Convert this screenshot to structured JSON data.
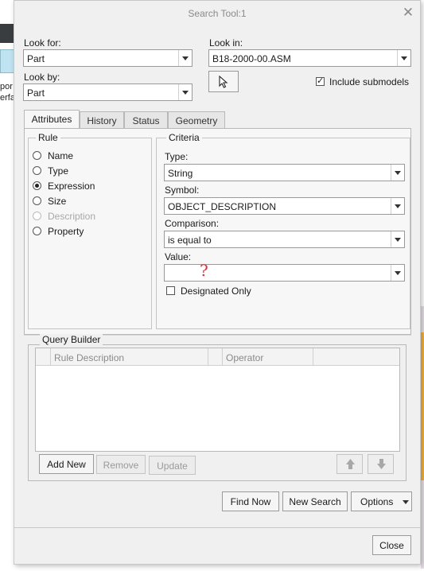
{
  "background_app": {
    "fragment_1": "por",
    "fragment_2": "erfa"
  },
  "dialog": {
    "title": "Search Tool:1",
    "close_glyph": "✕",
    "look_for": {
      "label": "Look for:",
      "value": "Part"
    },
    "look_by": {
      "label": "Look by:",
      "value": "Part"
    },
    "look_in": {
      "label": "Look in:",
      "value": "B18-2000-00.ASM"
    },
    "include_submodels": {
      "label": "Include submodels",
      "checked": true
    },
    "tabs": [
      {
        "label": "Attributes",
        "active": true
      },
      {
        "label": "History",
        "active": false
      },
      {
        "label": "Status",
        "active": false
      },
      {
        "label": "Geometry",
        "active": false
      }
    ],
    "rule": {
      "title": "Rule",
      "options": [
        {
          "label": "Name",
          "checked": false,
          "disabled": false
        },
        {
          "label": "Type",
          "checked": false,
          "disabled": false
        },
        {
          "label": "Expression",
          "checked": true,
          "disabled": false
        },
        {
          "label": "Size",
          "checked": false,
          "disabled": false
        },
        {
          "label": "Description",
          "checked": false,
          "disabled": true
        },
        {
          "label": "Property",
          "checked": false,
          "disabled": false
        }
      ]
    },
    "criteria": {
      "title": "Criteria",
      "type": {
        "label": "Type:",
        "value": "String"
      },
      "symbol": {
        "label": "Symbol:",
        "value": "OBJECT_DESCRIPTION"
      },
      "comparison": {
        "label": "Comparison:",
        "value": "is equal to"
      },
      "value": {
        "label": "Value:",
        "value": "",
        "annotation": "?"
      },
      "designated_only": {
        "label": "Designated Only",
        "checked": false
      }
    },
    "query_builder": {
      "title": "Query Builder",
      "columns": [
        "Rule Description",
        "Operator"
      ],
      "rows": [],
      "add_new": "Add New",
      "remove": "Remove",
      "update": "Update"
    },
    "buttons": {
      "find_now": "Find Now",
      "new_search": "New Search",
      "options": "Options",
      "close": "Close"
    }
  }
}
